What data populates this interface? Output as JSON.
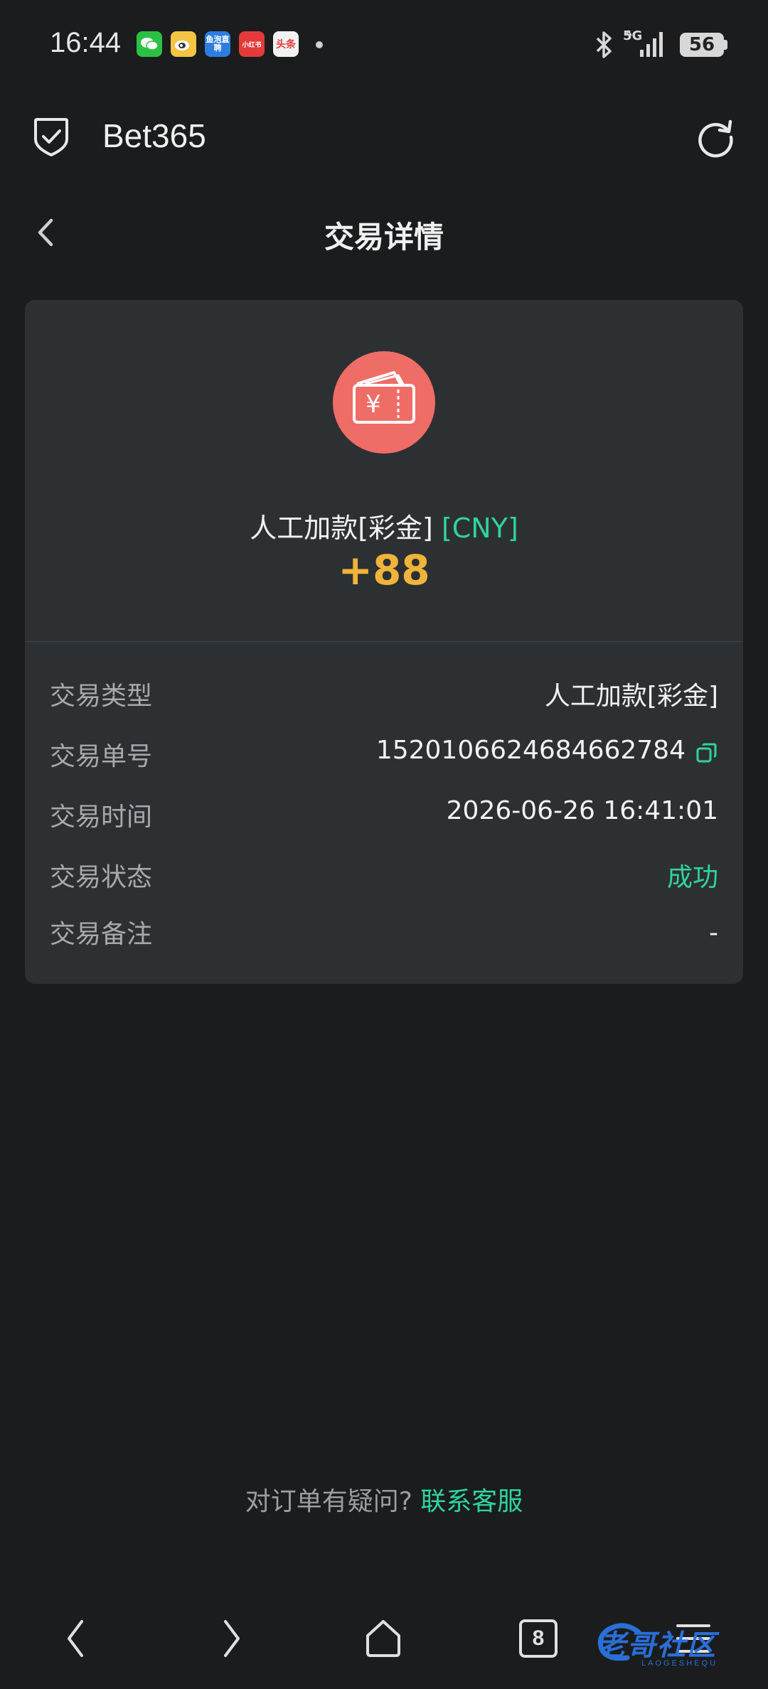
{
  "status_bar": {
    "time": "16:44",
    "notifications": [
      {
        "icon": "wechat-icon",
        "color": "#2bc142",
        "text": ""
      },
      {
        "icon": "weibo-icon",
        "color": "#f4c443",
        "text": ""
      },
      {
        "icon": "yupao-zhipin-icon",
        "color": "#2d7de0",
        "text": "鱼泡直聘"
      },
      {
        "icon": "xiaohongshu-icon",
        "color": "#e53a3a",
        "text": "小红书"
      },
      {
        "icon": "toutiao-icon",
        "color": "#f2f2f2",
        "text": "头条"
      }
    ],
    "network": "5G",
    "battery": "56"
  },
  "app_bar": {
    "title": "Bet365"
  },
  "page": {
    "title": "交易详情"
  },
  "transaction": {
    "name": "人工加款[彩金]",
    "currency": "[CNY]",
    "amount": "+88",
    "icon": "wallet-yuan-icon",
    "rows": [
      {
        "label": "交易类型",
        "value": "人工加款[彩金]"
      },
      {
        "label": "交易单号",
        "value": "1520106624684662784"
      },
      {
        "label": "交易时间",
        "value": "2026-06-26 16:41:01"
      },
      {
        "label": "交易状态",
        "value": "成功"
      },
      {
        "label": "交易备注",
        "value": "-"
      }
    ]
  },
  "footer": {
    "question": "对订单有疑问?",
    "contact_link": "联系客服"
  },
  "bottom_nav": {
    "tabs_count": "8"
  },
  "watermark": {
    "text": "老哥社区",
    "sub": "LAOGESHEQU"
  },
  "colors": {
    "accent_green": "#2fd49e",
    "amount_orange": "#f0b43a",
    "icon_red": "#ef6d67",
    "card_bg": "#2c3032",
    "page_bg": "#1a1c1d"
  }
}
